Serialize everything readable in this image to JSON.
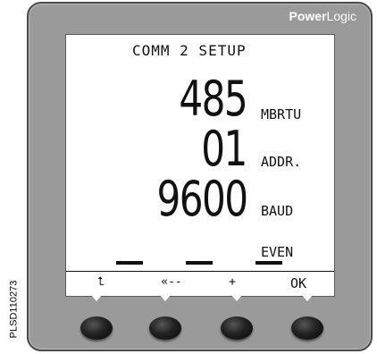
{
  "side_code": "PLSD110273",
  "brand": {
    "bold": "Power",
    "regular": "Logic"
  },
  "lcd": {
    "title": "COMM 2 SETUP",
    "rows": [
      {
        "value": "485",
        "label": "MBRTU"
      },
      {
        "value": "01",
        "label": "ADDR."
      },
      {
        "value": "9600",
        "label": "BAUD"
      }
    ],
    "parity_label": "EVEN"
  },
  "softkeys": {
    "key1": "⮤",
    "key2": "«--",
    "key3": "+",
    "key4": "OK"
  },
  "colors": {
    "bezel": "#9a9a9a",
    "lcd_background": "#ffffff",
    "button": "#111111"
  }
}
